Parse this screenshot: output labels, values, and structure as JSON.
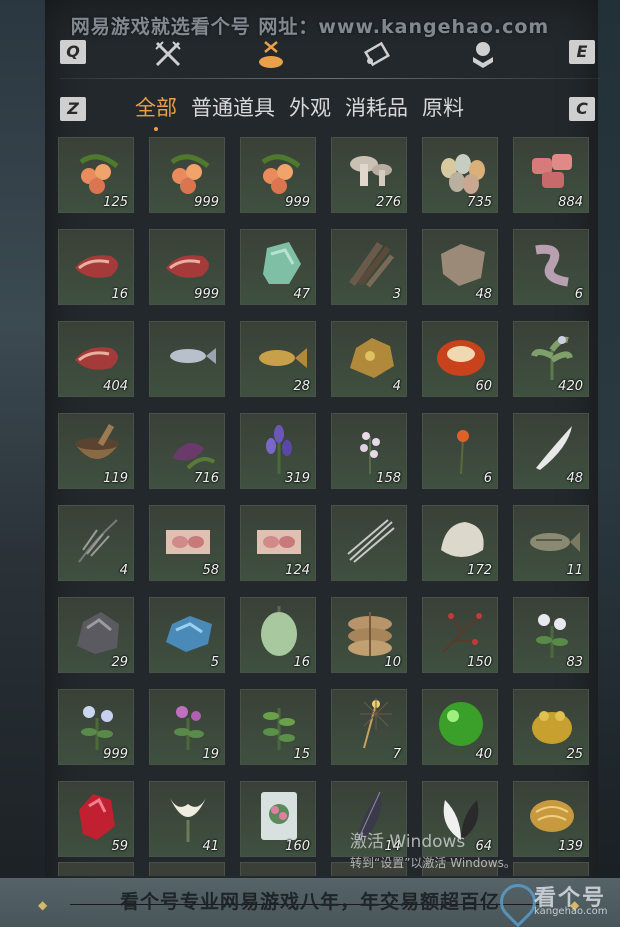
{
  "watermark_top": "网易游戏就选看个号  网址：www.kangehao.com",
  "keys": {
    "q": "Q",
    "e": "E",
    "z": "Z",
    "c": "C"
  },
  "top_icons": [
    "crossed-swords-icon",
    "pouch-icon",
    "scroll-icon",
    "badge-icon"
  ],
  "tabs": [
    {
      "label": "全部",
      "active": true
    },
    {
      "label": "普通道具",
      "active": false
    },
    {
      "label": "外观",
      "active": false
    },
    {
      "label": "消耗品",
      "active": false
    },
    {
      "label": "原料",
      "active": false
    }
  ],
  "items": [
    {
      "icon": "berries-icon",
      "count": "125"
    },
    {
      "icon": "berries-icon",
      "count": "999"
    },
    {
      "icon": "berries-icon",
      "count": "999"
    },
    {
      "icon": "mushrooms-icon",
      "count": "276"
    },
    {
      "icon": "eggs-icon",
      "count": "735"
    },
    {
      "icon": "meat-chunks-icon",
      "count": "884"
    },
    {
      "icon": "steak-icon",
      "count": "16"
    },
    {
      "icon": "steak-icon",
      "count": "999"
    },
    {
      "icon": "jade-ore-icon",
      "count": "47"
    },
    {
      "icon": "feathers-icon",
      "count": "3"
    },
    {
      "icon": "hide-icon",
      "count": "48"
    },
    {
      "icon": "intestine-icon",
      "count": "6"
    },
    {
      "icon": "steak-icon",
      "count": "404"
    },
    {
      "icon": "fish-icon",
      "count": ""
    },
    {
      "icon": "carp-icon",
      "count": "28"
    },
    {
      "icon": "gold-ore-icon",
      "count": "4"
    },
    {
      "icon": "amber-gem-icon",
      "count": "60"
    },
    {
      "icon": "herb-icon",
      "count": "420"
    },
    {
      "icon": "mortar-icon",
      "count": "119"
    },
    {
      "icon": "purple-herb-icon",
      "count": "716"
    },
    {
      "icon": "lavender-icon",
      "count": "319"
    },
    {
      "icon": "white-flower-icon",
      "count": "158"
    },
    {
      "icon": "red-flower-icon",
      "count": "6"
    },
    {
      "icon": "white-feather-icon",
      "count": "48"
    },
    {
      "icon": "dark-feather-icon",
      "count": "4"
    },
    {
      "icon": "raw-meat-icon",
      "count": "58"
    },
    {
      "icon": "raw-meat-icon",
      "count": "124"
    },
    {
      "icon": "quills-icon",
      "count": ""
    },
    {
      "icon": "fur-icon",
      "count": "172"
    },
    {
      "icon": "scaled-fish-icon",
      "count": "11"
    },
    {
      "icon": "iron-ore-icon",
      "count": "29"
    },
    {
      "icon": "blue-ore-icon",
      "count": "5"
    },
    {
      "icon": "gourd-icon",
      "count": "16"
    },
    {
      "icon": "sack-bundle-icon",
      "count": "10"
    },
    {
      "icon": "red-berry-branch-icon",
      "count": "150"
    },
    {
      "icon": "white-blossom-icon",
      "count": "83"
    },
    {
      "icon": "blue-blossom-icon",
      "count": "999"
    },
    {
      "icon": "pink-blossom-icon",
      "count": "19"
    },
    {
      "icon": "green-herb-icon",
      "count": "15"
    },
    {
      "icon": "firework-icon",
      "count": "7"
    },
    {
      "icon": "green-orb-icon",
      "count": "40"
    },
    {
      "icon": "gold-toad-icon",
      "count": "25"
    },
    {
      "icon": "red-crystal-icon",
      "count": "59"
    },
    {
      "icon": "lily-icon",
      "count": "41"
    },
    {
      "icon": "flower-pack-icon",
      "count": "160"
    },
    {
      "icon": "black-quill-icon",
      "count": "14"
    },
    {
      "icon": "black-white-feather-icon",
      "count": "64"
    },
    {
      "icon": "gold-nugget-icon",
      "count": "139"
    }
  ],
  "activate_windows": {
    "title": "激活 Windows",
    "subtitle": "转到“设置”以激活 Windows。"
  },
  "banner_text": "看个号专业网易游戏八年，年交易额超百亿",
  "logo": {
    "name": "看个号",
    "url": "kangehao.com"
  },
  "colors": {
    "accent": "#e8a04a",
    "slot_bg": "#3d4a3c",
    "panel_bg": "#23282c"
  }
}
